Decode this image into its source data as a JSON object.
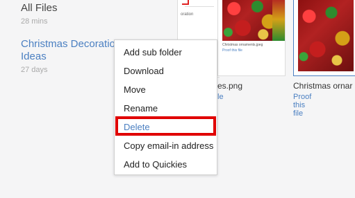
{
  "folders": [
    {
      "name": "All Files",
      "time": "28 mins"
    },
    {
      "name": "Christmas Decoration Ideas",
      "time": "27 days"
    }
  ],
  "files": [
    {
      "name": "es.png",
      "proof": "le",
      "thumb_caption": "Christmas ornaments.jpeg",
      "thumb_proof": "Proof this file",
      "fragment_text": "oration"
    },
    {
      "name": "Christmas ornar",
      "proof": "Proof this file"
    }
  ],
  "context_menu": {
    "items": [
      "Add sub folder",
      "Download",
      "Move",
      "Rename",
      "Delete",
      "Copy email-in address",
      "Add to Quickies"
    ],
    "highlighted": "Delete"
  },
  "colors": {
    "link": "#4a7fc1",
    "highlight": "#e00000",
    "background": "#f5f5f6"
  }
}
